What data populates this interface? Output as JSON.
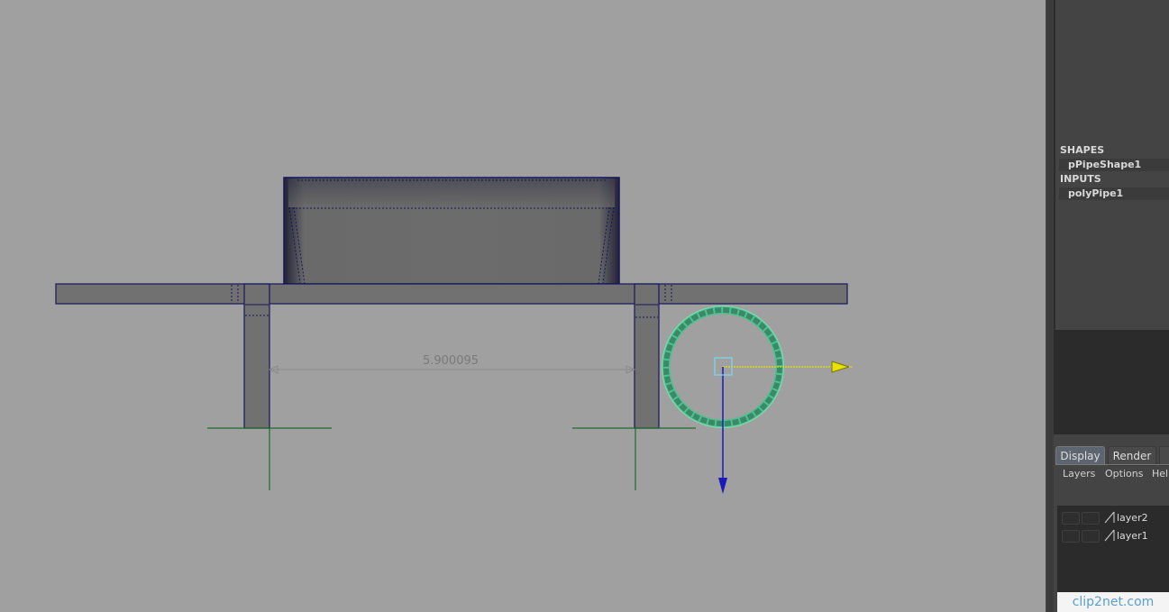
{
  "viewport": {
    "dimension_value": "5.900095",
    "manipulator": {
      "x_axis_color": "#e8e000",
      "y_axis_color": "#1a1ab8",
      "selection_color": "#4fc090"
    }
  },
  "channel_box": {
    "shapes_header": "SHAPES",
    "shape_node": "pPipeShape1",
    "inputs_header": "INPUTS",
    "input_node": "polyPipe1"
  },
  "layer_editor": {
    "tabs": [
      "Display",
      "Render"
    ],
    "active_tab": "Display",
    "menus": [
      "Layers",
      "Options",
      "Help"
    ],
    "layers": [
      "layer2",
      "layer1"
    ]
  },
  "watermark": {
    "text": "clip2net.com"
  },
  "colors": {
    "viewport_bg": "#a0a0a0",
    "panel_bg": "#444444",
    "wire": "#1c1c6e",
    "mesh_fill": "#6e6e6e",
    "grid_line": "#1f6a2c"
  }
}
